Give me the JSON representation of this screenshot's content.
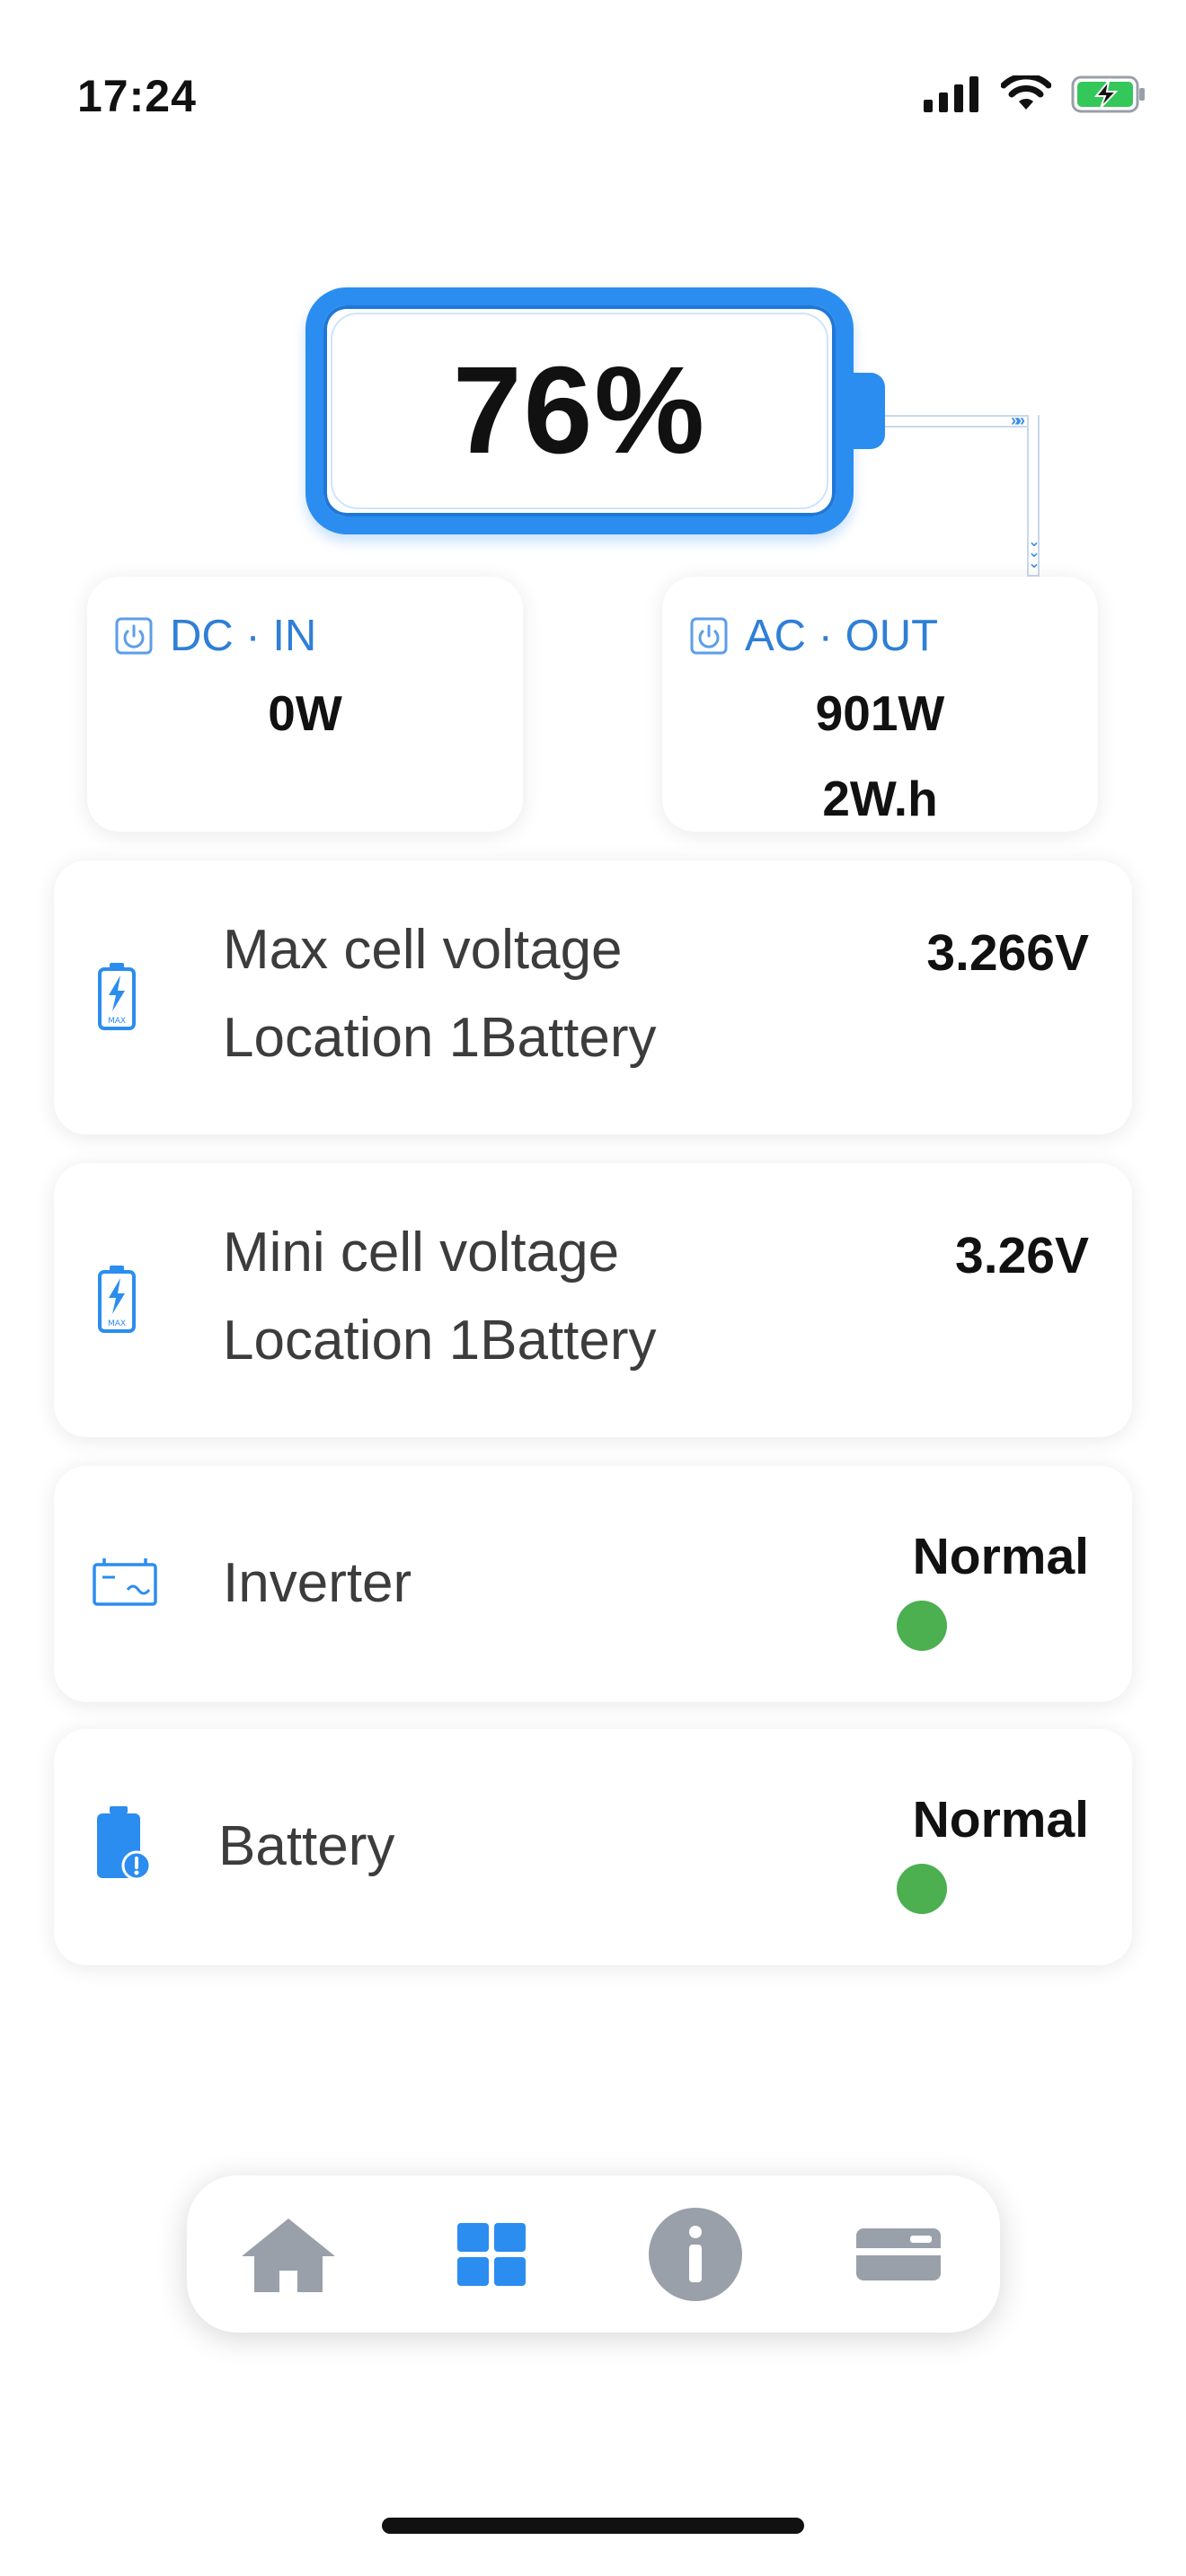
{
  "status_bar": {
    "time": "17:24"
  },
  "gauge": {
    "percent_label": "76%",
    "level": 0.76
  },
  "dc_in": {
    "label": "DC · IN",
    "power": "0W"
  },
  "ac_out": {
    "label": "AC · OUT",
    "power": "901W",
    "energy": "2W.h"
  },
  "rows": [
    {
      "title_line1": "Max cell voltage",
      "title_line2": "Location 1Battery",
      "value": "3.266V"
    },
    {
      "title_line1": "Mini cell voltage",
      "title_line2": "Location 1Battery",
      "value": "3.26V"
    },
    {
      "title": "Inverter",
      "status": "Normal",
      "status_color": "#4caf50"
    },
    {
      "title": "Battery",
      "status": "Normal",
      "status_color": "#4caf50"
    }
  ],
  "icons": {
    "max_cell": "battery-max-icon",
    "mini_cell": "battery-max-icon",
    "inverter": "inverter-icon",
    "battery": "battery-alert-icon"
  },
  "nav": [
    "home-icon",
    "grid-icon",
    "info-icon",
    "card-icon"
  ],
  "colors": {
    "accent": "#2b8def",
    "ok": "#4caf50",
    "nav_inactive": "#9aa0aa",
    "nav_active": "#2b8def"
  }
}
